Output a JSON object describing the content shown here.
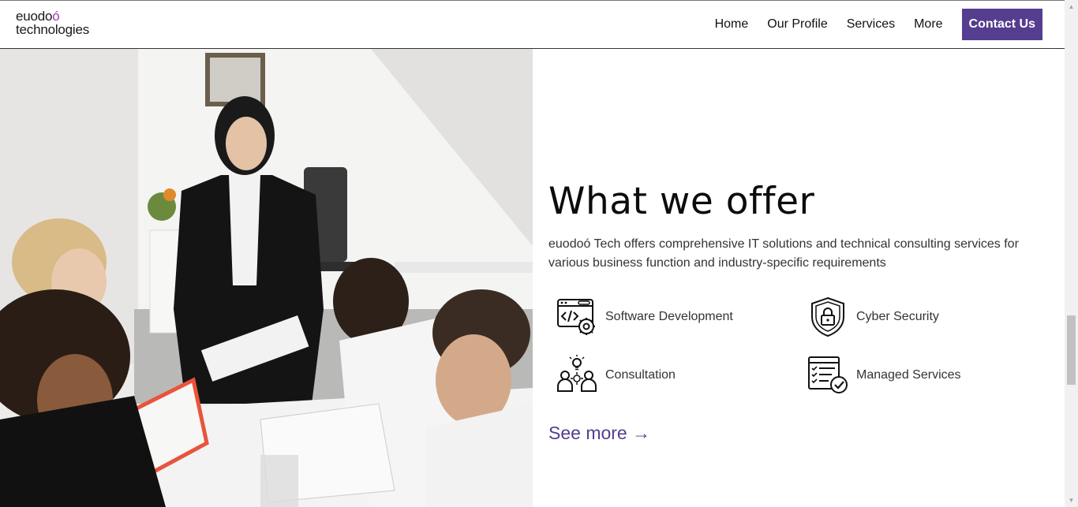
{
  "header": {
    "logo_line1_main": "euodo",
    "logo_line1_accent": "ó",
    "logo_line2": "technologies",
    "nav": [
      "Home",
      "Our Profile",
      "Services",
      "More"
    ],
    "contact_label": "Contact Us"
  },
  "section": {
    "title": "What we offer",
    "description": "euodoó Tech offers comprehensive IT solutions and technical consulting services for various business function and industry-specific requirements",
    "services": [
      {
        "label": "Software Development",
        "icon": "code-gear-icon"
      },
      {
        "label": "Cyber Security",
        "icon": "shield-lock-icon"
      },
      {
        "label": "Consultation",
        "icon": "people-idea-icon"
      },
      {
        "label": "Managed Services",
        "icon": "checklist-icon"
      }
    ],
    "see_more": "See more →"
  },
  "colors": {
    "brand": "#553d8f",
    "logo_accent": "#9b3bb0"
  }
}
